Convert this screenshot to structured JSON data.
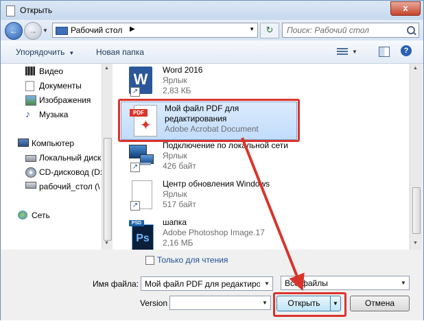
{
  "window": {
    "title": "Открыть",
    "close_glyph": "x"
  },
  "nav": {
    "address": "Рабочий стол",
    "search_placeholder": "Поиск: Рабочий стол"
  },
  "toolbar": {
    "organize": "Упорядочить",
    "new_folder": "Новая папка"
  },
  "sidebar": {
    "items": [
      {
        "label": "Видео",
        "icon": "video-folder-icon"
      },
      {
        "label": "Документы",
        "icon": "documents-folder-icon"
      },
      {
        "label": "Изображения",
        "icon": "pictures-folder-icon"
      },
      {
        "label": "Музыка",
        "icon": "music-folder-icon"
      },
      {
        "label": "Компьютер",
        "icon": "computer-icon"
      },
      {
        "label": "Локальный диск",
        "icon": "hard-drive-icon"
      },
      {
        "label": "CD-дисковод (D:",
        "icon": "cd-drive-icon"
      },
      {
        "label": "рабочий_стол (\\",
        "icon": "network-drive-icon"
      },
      {
        "label": "Сеть",
        "icon": "network-icon"
      }
    ]
  },
  "files": [
    {
      "name": "Word 2016",
      "type": "Ярлык",
      "size": "2,83 КБ",
      "icon": "word-icon"
    },
    {
      "name": "Мой файл PDF для",
      "name2": "редактирования",
      "type": "Adobe Acrobat Document",
      "icon": "pdf-icon"
    },
    {
      "name": "Подключение по локальной сети",
      "type": "Ярлык",
      "size": "426 байт",
      "icon": "network-connection-icon"
    },
    {
      "name": "Центр обновления Windows",
      "type": "Ярлык",
      "size": "517 байт",
      "icon": "windows-update-icon"
    },
    {
      "name": "шапка",
      "type": "Adobe Photoshop Image.17",
      "size": "2,16 МБ",
      "icon": "photoshop-icon"
    }
  ],
  "bottom": {
    "readonly": "Только для чтения",
    "filename_label": "Имя файла:",
    "filename_value": "Мой файл PDF для редактиров",
    "filter_value": "Все файлы",
    "version_label": "Version",
    "version_value": "",
    "open": "Открыть",
    "cancel": "Отмена"
  },
  "colors": {
    "highlight": "#d9342b",
    "selection": "#c1dcfc",
    "link": "#1f4e99"
  }
}
